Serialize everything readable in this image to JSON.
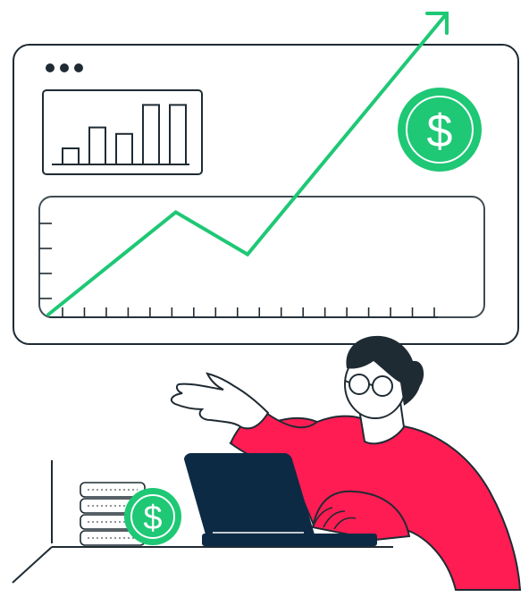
{
  "illustration": {
    "subject": "growth-analytics",
    "colors": {
      "outline": "#1f2b33",
      "growth_line": "#1ec875",
      "coin": "#1ec875",
      "coin_symbol": "#ffffff",
      "shirt": "#ff1c53",
      "laptop": "#0d2a45",
      "hair": "#1f2b33",
      "background": "#ffffff"
    },
    "icons": {
      "window_dots": "three-dots-icon",
      "dollar_coin": "dollar-coin-icon",
      "trend_arrow": "arrow-up-right-icon",
      "bar_chart": "bar-chart-icon"
    },
    "mini_bar_chart": {
      "values": [
        1,
        2.3,
        1.9,
        3.7,
        3.7
      ],
      "max": 4
    },
    "growth_trend": {
      "points": [
        [
          0,
          0
        ],
        [
          1.6,
          1.7
        ],
        [
          2.5,
          1.0
        ],
        [
          5.0,
          5.0
        ]
      ]
    },
    "x_axis_tick_count": 18,
    "y_axis_tick_count": 4,
    "coin_stack_count": 4,
    "dollar_symbol": "$"
  }
}
